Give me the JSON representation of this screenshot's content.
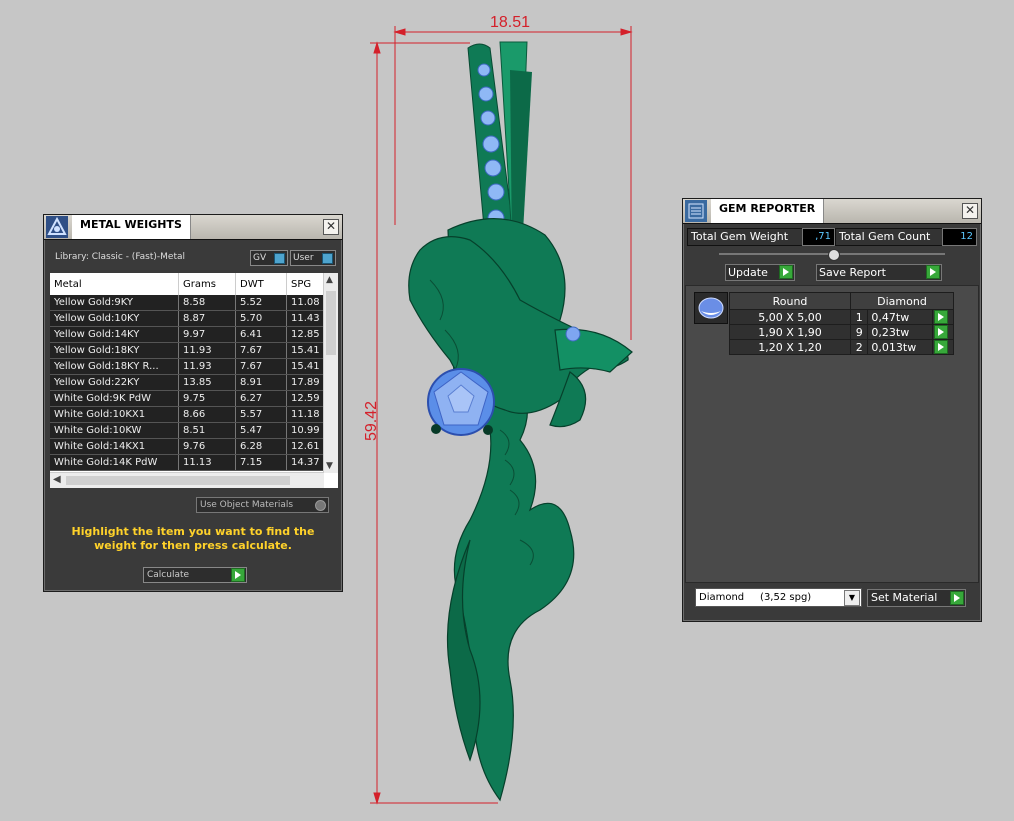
{
  "viewport": {
    "dimension_width": "18.51",
    "dimension_height": "59.42",
    "background_color": "#c6c6c6",
    "model_color": "#0f7a55",
    "gem_color": "#5b8ee8",
    "dimension_color": "#d4202a"
  },
  "metal_panel": {
    "title": "METAL WEIGHTS",
    "library": "Library: Classic - (Fast)-Metal",
    "toggle_gv": "GV",
    "toggle_user": "User",
    "columns": [
      "Metal",
      "Grams",
      "DWT",
      "SPG"
    ],
    "rows": [
      [
        "Yellow Gold:9KY",
        "8.58",
        "5.52",
        "11.08"
      ],
      [
        "Yellow Gold:10KY",
        "8.87",
        "5.70",
        "11.43"
      ],
      [
        "Yellow Gold:14KY",
        "9.97",
        "6.41",
        "12.85"
      ],
      [
        "Yellow Gold:18KY",
        "11.93",
        "7.67",
        "15.41"
      ],
      [
        "Yellow Gold:18KY R...",
        "11.93",
        "7.67",
        "15.41"
      ],
      [
        "Yellow Gold:22KY",
        "13.85",
        "8.91",
        "17.89"
      ],
      [
        "White Gold:9K PdW",
        "9.75",
        "6.27",
        "12.59"
      ],
      [
        "White Gold:10KX1",
        "8.66",
        "5.57",
        "11.18"
      ],
      [
        "White Gold:10KW",
        "8.51",
        "5.47",
        "10.99"
      ],
      [
        "White Gold:14KX1",
        "9.76",
        "6.28",
        "12.61"
      ],
      [
        "White Gold:14K PdW",
        "11.13",
        "7.15",
        "14.37"
      ]
    ],
    "use_object_materials": "Use Object Materials",
    "hint": "Highlight the item you want to find the weight for then press calculate.",
    "calculate": "Calculate"
  },
  "gem_panel": {
    "title": "GEM REPORTER",
    "total_weight_label": "Total Gem Weight",
    "total_weight_value": ",71",
    "total_count_label": "Total Gem Count",
    "total_count_value": "12",
    "update": "Update",
    "save_report": "Save Report",
    "table_headers": [
      "Round",
      "Diamond"
    ],
    "gems": [
      {
        "size": "5,00 X 5,00",
        "count": "1",
        "weight": "0,47tw"
      },
      {
        "size": "1,90 X 1,90",
        "count": "9",
        "weight": "0,23tw"
      },
      {
        "size": "1,20 X 1,20",
        "count": "2",
        "weight": "0,013tw"
      }
    ],
    "material_select": "Diamond     (3,52 spg)",
    "set_material": "Set Material"
  }
}
